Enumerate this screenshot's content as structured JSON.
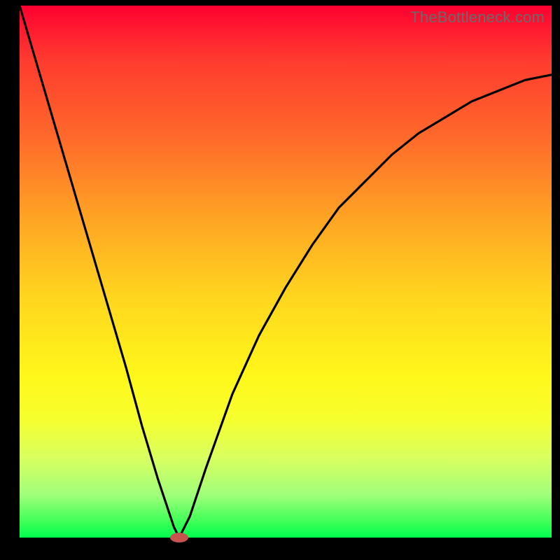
{
  "watermark": "TheBottleneck.com",
  "colors": {
    "frame": "#000000",
    "curve": "#000000",
    "touchpoint": "#c7534f",
    "gradient_top": "#ff0030",
    "gradient_bottom": "#00ff4e"
  },
  "chart_data": {
    "type": "line",
    "title": "",
    "xlabel": "",
    "ylabel": "",
    "xlim": [
      0,
      100
    ],
    "ylim": [
      0,
      100
    ],
    "series": [
      {
        "name": "bottleneck-curve",
        "x": [
          0,
          5,
          10,
          15,
          20,
          23,
          26,
          29,
          30,
          32,
          35,
          40,
          45,
          50,
          55,
          60,
          65,
          70,
          75,
          80,
          85,
          90,
          95,
          100
        ],
        "y": [
          100,
          83,
          66,
          49,
          32,
          21,
          11,
          2,
          0,
          4,
          13,
          27,
          38,
          47,
          55,
          62,
          67,
          72,
          76,
          79,
          82,
          84,
          86,
          87
        ]
      }
    ],
    "annotations": [
      {
        "name": "optimal-point",
        "x": 30,
        "y": 0
      }
    ]
  }
}
